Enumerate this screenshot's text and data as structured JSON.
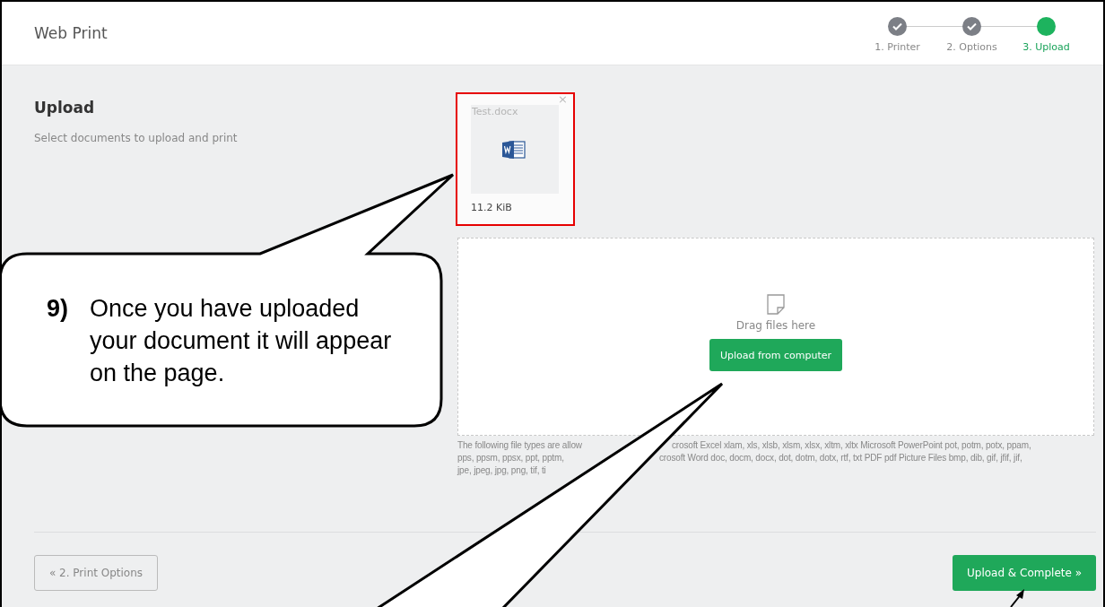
{
  "window": {
    "title": "Web Print"
  },
  "steps": [
    {
      "label": "1. Printer",
      "completed": true,
      "selected": false
    },
    {
      "label": "2. Options",
      "completed": true,
      "selected": false
    },
    {
      "label": "3. Upload",
      "completed": false,
      "selected": true
    }
  ],
  "section": {
    "title": "Upload",
    "subtitle": "Select documents to upload and print"
  },
  "files": [
    {
      "name": "Test.docx",
      "size": "11.2 KiB",
      "remove": "×",
      "highlighted": true
    }
  ],
  "dropzone": {
    "hint": "Drag files here",
    "button": "Upload from computer"
  },
  "file_types_note": [
    {
      "segments": [
        "The following file types are allow",
        "crosoft Excel xlam, xls, xlsb, xlsm, xlsx, xltm, xltx Microsoft PowerPoint pot, potm, potx, ppam,"
      ]
    },
    {
      "segments": [
        "pps, ppsm, ppsx, ppt, pptm,",
        "crosoft Word doc, docm, docx, dot, dotm, dotx, rtf, txt PDF pdf Picture Files bmp, dib, gif, jfif, jif,"
      ]
    },
    {
      "segments": [
        "jpe, jpeg, jpg, png, tif, ti"
      ]
    }
  ],
  "footer": {
    "back": "« 2. Print Options",
    "next": "Upload & Complete »"
  },
  "callout": {
    "number": "9)",
    "text": "Once you have uploaded your document it will appear on the page."
  }
}
